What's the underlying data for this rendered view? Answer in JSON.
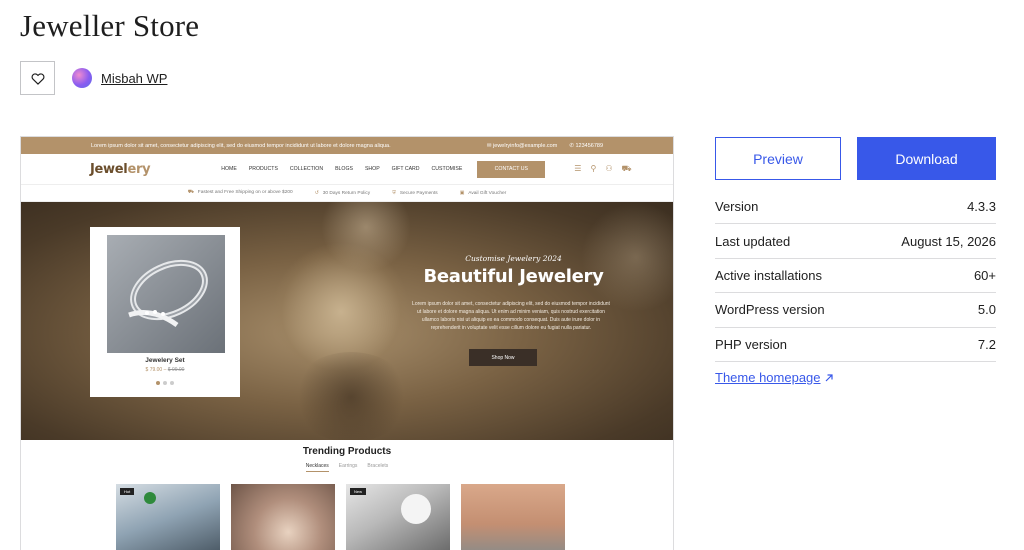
{
  "page": {
    "title": "Jeweller Store",
    "author": "Misbah WP",
    "favorite_icon": "heart-outline-icon"
  },
  "preview_site": {
    "topbar_text": "Lorem ipsum dolor sit amet, consectetur adipiscing elit, sed do eiusmod tempor incididunt ut labore et dolore magna aliqua.",
    "email": "jewelryinfo@example.com",
    "phone": "123456789",
    "logo_part1": "Jewel",
    "logo_part2": "ery",
    "menu": [
      "HOME",
      "PRODUCTS",
      "COLLECTION",
      "BLOGS",
      "SHOP",
      "GIFT CARD",
      "CUSTOMISE"
    ],
    "contact_label": "CONTACT US",
    "info_items": [
      "Fastest and Free Shipping on or above $200",
      "30 Days Return Policy",
      "Secure Payments",
      "Avail Gift Voucher"
    ],
    "card": {
      "title": "Jewelery Set",
      "price": "$ 79.00",
      "old_price": "$ 99.00"
    },
    "hero": {
      "subtitle": "Customise Jewelery 2024",
      "title": "Beautiful Jewelery",
      "text": "Lorem ipsum dolor sit amet, consectetur adipiscing elit, sed do eiusmod tempor incididunt ut labore et dolore magna aliqua. Ut enim ad minim veniam, quis nostrud exercitation ullamco laboris nisi ut aliquip ex ea commodo consequat. Duis aute irure dolor in reprehenderit in voluptate velit esse cillum dolore eu fugiat nulla pariatur.",
      "button": "Shop Now"
    },
    "trending": {
      "title": "Trending Products",
      "tabs": [
        "Necklaces",
        "Earrings",
        "Bracelets"
      ],
      "tags": [
        "Hot",
        "New"
      ]
    }
  },
  "sidebar": {
    "preview_label": "Preview",
    "download_label": "Download",
    "meta": [
      {
        "label": "Version",
        "value": "4.3.3"
      },
      {
        "label": "Last updated",
        "value": "August 15, 2026"
      },
      {
        "label": "Active installations",
        "value": "60+"
      },
      {
        "label": "WordPress version",
        "value": "5.0"
      },
      {
        "label": "PHP version",
        "value": "7.2"
      }
    ],
    "theme_homepage": "Theme homepage",
    "link_icon": "external-arrow-icon"
  },
  "colors": {
    "accent": "#3858e9",
    "brand_gold": "#b3926a"
  }
}
